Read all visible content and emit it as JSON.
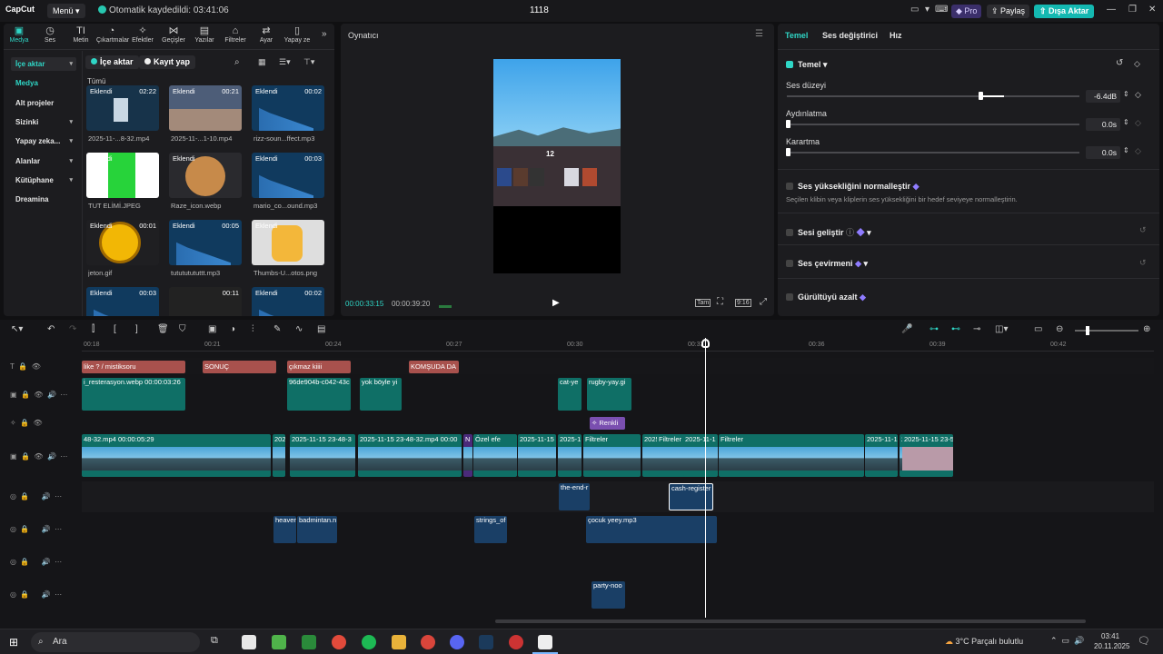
{
  "app": {
    "logo": "CapCut",
    "menu": "Menü",
    "autosave": "Otomatik kaydedildi: 03:41:06",
    "project_title": "1118",
    "pro": "Pro",
    "share": "Paylaş",
    "export": "Dışa Aktar"
  },
  "tools": [
    {
      "label": "Medya",
      "icon": "▣"
    },
    {
      "label": "Ses",
      "icon": "◷"
    },
    {
      "label": "Metin",
      "icon": "TI"
    },
    {
      "label": "Çıkartmalar",
      "icon": "◔"
    },
    {
      "label": "Efektler",
      "icon": "✧"
    },
    {
      "label": "Geçişler",
      "icon": "⋈"
    },
    {
      "label": "Yazılar",
      "icon": "▤"
    },
    {
      "label": "Filtreler",
      "icon": "⌂"
    },
    {
      "label": "Ayar",
      "icon": "⇄"
    },
    {
      "label": "Yapay ze",
      "icon": "▯"
    }
  ],
  "sidebar": [
    "İçe aktar",
    "Medya",
    "Alt projeler",
    "Sizinki",
    "Yapay zeka...",
    "Alanlar",
    "Kütüphane",
    "Dreamina"
  ],
  "media_toolbar": {
    "import": "İçe aktar",
    "record": "Kayıt yap",
    "all": "Tümü"
  },
  "media": [
    {
      "tag": "Eklendi",
      "dur": "02:22",
      "caption": "2025-11-...8-32.mp4",
      "kind": "video"
    },
    {
      "tag": "Eklendi",
      "dur": "00:21",
      "caption": "2025-11-...1-10.mp4",
      "kind": "video2"
    },
    {
      "tag": "Eklendi",
      "dur": "00:02",
      "caption": "rizz-soun...ffect.mp3",
      "kind": "audio"
    },
    {
      "tag": "Eklendi",
      "dur": "",
      "caption": "TUT ELİMİ.JPEG",
      "kind": "green"
    },
    {
      "tag": "Eklendi",
      "dur": "",
      "caption": "Raze_icon.webp",
      "kind": "raze"
    },
    {
      "tag": "Eklendi",
      "dur": "00:03",
      "caption": "mario_co...ound.mp3",
      "kind": "audio"
    },
    {
      "tag": "Eklendi",
      "dur": "00:01",
      "caption": "jeton.gif",
      "kind": "coin"
    },
    {
      "tag": "Eklendi",
      "dur": "00:05",
      "caption": "tutututututtt.mp3",
      "kind": "audio"
    },
    {
      "tag": "Eklendi",
      "dur": "",
      "caption": "Thumbs-U...otos.png",
      "kind": "thumb"
    },
    {
      "tag": "Eklendi",
      "dur": "00:03",
      "caption": "",
      "kind": "audio"
    },
    {
      "tag": "",
      "dur": "00:11",
      "caption": "",
      "kind": "dark"
    },
    {
      "tag": "Eklendi",
      "dur": "00:02",
      "caption": "",
      "kind": "audio"
    }
  ],
  "player": {
    "title": "Oynatıcı",
    "current": "00:00:33:15",
    "total": "00:00:39:20",
    "full": "Tam",
    "ratio": "9:16",
    "hud_number": "12"
  },
  "inspector": {
    "tabs": [
      "Temel",
      "Ses değiştirici",
      "Hız"
    ],
    "section": "Temel",
    "volume": {
      "label": "Ses düzeyi",
      "value": "-6.4dB",
      "level": 0.66
    },
    "fadein": {
      "label": "Aydınlatma",
      "value": "0.0s",
      "level": 0
    },
    "fadeout": {
      "label": "Karartma",
      "value": "0.0s",
      "level": 0
    },
    "normalize": "Ses yüksekliğini normalleştir",
    "normalize_desc": "Seçilen klibin veya kliplerin ses yüksekliğini bir hedef seviyeye normalleştirin.",
    "enhance": "Sesi geliştir",
    "voice": "Ses çevirmeni",
    "denoise": "Gürültüyü azalt"
  },
  "ruler": [
    "00:18",
    "00:21",
    "00:24",
    "00:27",
    "00:30",
    "00:33",
    "00:36",
    "00:39",
    "00:42"
  ],
  "text_clips": [
    "like ? / mistiksoru",
    "SONUÇ",
    "çıkmaz kiiii",
    "KOMŞUDA DA"
  ],
  "sticker_clips": [
    "i_resterasyon.webp  00:00:03:26",
    "96de904b-c042-43c",
    "yok böyle yi",
    "cat-ye",
    "rugby-yay.gi"
  ],
  "effect_clip": "Renkli",
  "main_clips": [
    "48-32.mp4  00:00:05:29",
    "202",
    "2025-11-15 23-48-3",
    "2025-11-15 23-48-32.mp4  00:00",
    "N",
    "Özel efe",
    "2025-11-15 2",
    "2025-1",
    "Filtreler",
    "2025-",
    "Filtreler",
    "2025-11-1",
    "Filtreler",
    "2025-11-15 23-48-32.mp4  00:00",
    "2025-11-1",
    "2025-11-15 23-5"
  ],
  "audio_clips": [
    "the-end-r",
    "cash-register",
    "heaver",
    "badmintan.n",
    "strings_of",
    "çocuk yeey.mp3",
    "party-noo"
  ],
  "taskbar": {
    "search": "Ara",
    "weather": "3°C  Parçalı bulutlu",
    "time": "03:41",
    "date": "20.11.2025"
  }
}
